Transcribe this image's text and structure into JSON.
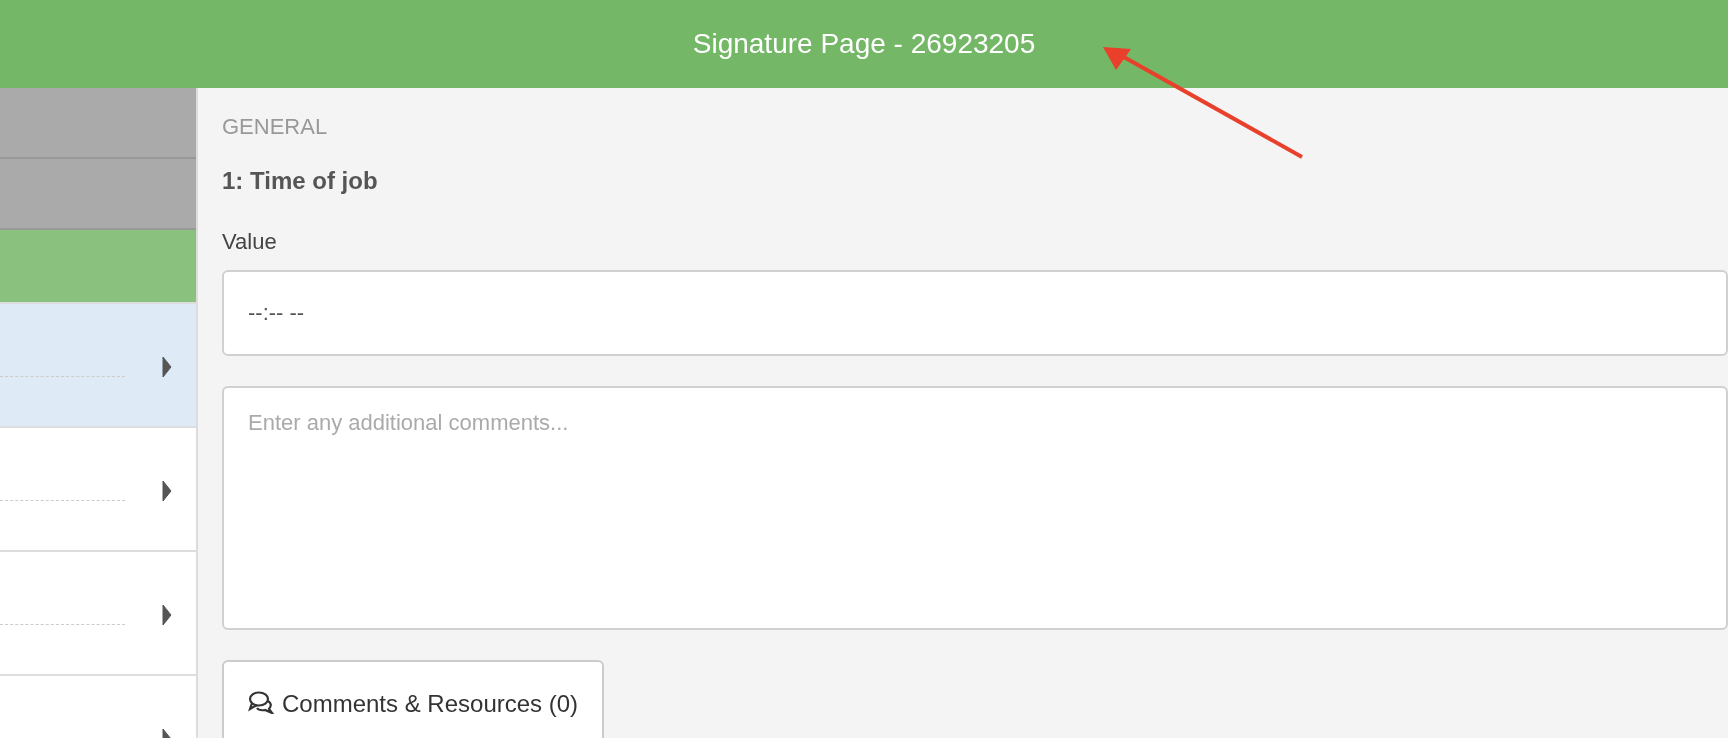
{
  "header": {
    "title": "Signature Page - 26923205"
  },
  "sidebar": {
    "items": [
      {
        "kind": "header",
        "selected": false
      },
      {
        "kind": "header",
        "selected": false
      },
      {
        "kind": "section",
        "selected": false
      },
      {
        "kind": "question",
        "selected": true
      },
      {
        "kind": "question",
        "selected": false
      },
      {
        "kind": "question",
        "selected": false
      },
      {
        "kind": "question",
        "selected": false
      }
    ]
  },
  "main": {
    "section": "GENERAL",
    "question": "1: Time of job",
    "field_label": "Value",
    "value": "--:-- --",
    "comments_placeholder": "Enter any additional comments...",
    "comments_button": "Comments & Resources (0)"
  },
  "annotation": {
    "kind": "arrow"
  }
}
